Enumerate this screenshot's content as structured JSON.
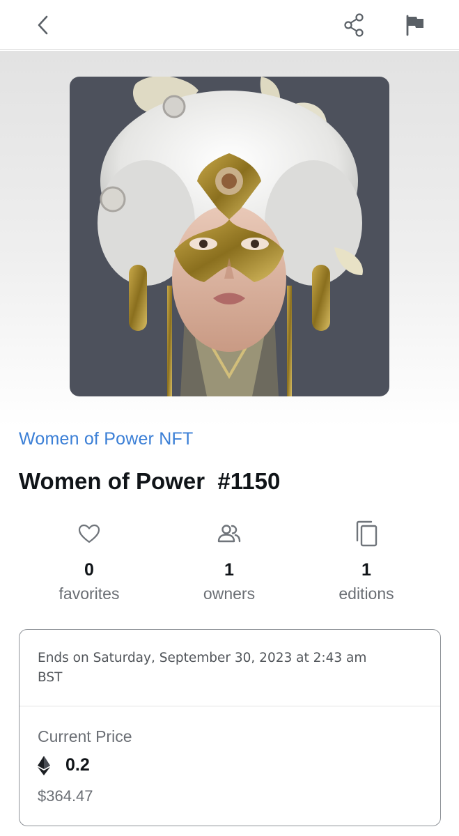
{
  "header": {
    "back_icon": "chevron-left-icon",
    "share_icon": "share-icon",
    "flag_icon": "flag-icon"
  },
  "nft": {
    "collection": "Women of Power NFT",
    "title": "Women of Power  #1150",
    "image_alt": "masked woman portrait artwork"
  },
  "stats": [
    {
      "icon": "heart-icon",
      "value": "0",
      "label": "favorites"
    },
    {
      "icon": "users-icon",
      "value": "1",
      "label": "owners"
    },
    {
      "icon": "copy-icon",
      "value": "1",
      "label": "editions"
    }
  ],
  "sale": {
    "ends": "Ends on Saturday, September 30, 2023 at 2:43 am BST",
    "price_label": "Current Price",
    "currency_icon": "ethereum-icon",
    "price_eth": "0.2",
    "price_usd": "$364.47"
  },
  "colors": {
    "accent": "#3b7fd6",
    "text": "#101418",
    "muted": "#6a6e74",
    "art_background": "#4d515c"
  }
}
